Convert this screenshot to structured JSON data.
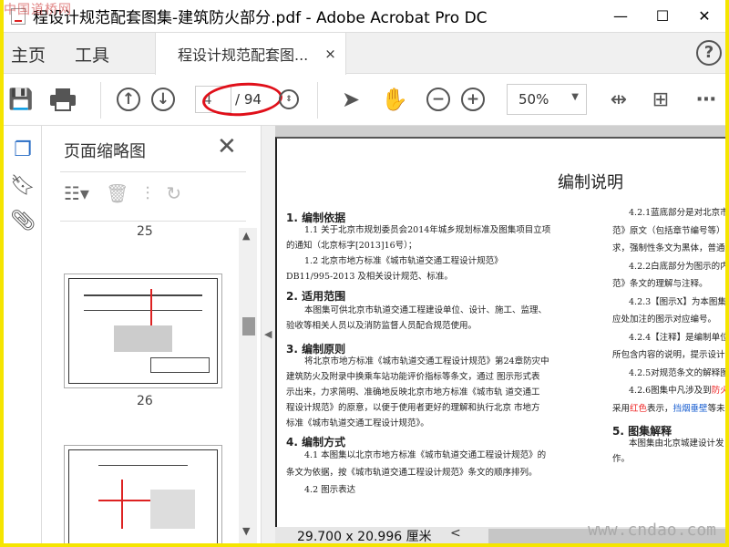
{
  "watermark_top": "中国道桥网",
  "watermark_bottom": "www.cndao.com",
  "window": {
    "title": "程设计规范配套图集-建筑防火部分.pdf - Adobe Acrobat Pro DC",
    "minimize": "—",
    "maximize": "☐",
    "close": "✕"
  },
  "tabs": {
    "home": "主页",
    "tools": "工具",
    "document": "程设计规范配套图...",
    "close": "×",
    "help": "?"
  },
  "toolbar": {
    "current_page": "4",
    "total_pages": "/ 94",
    "zoom": "50%"
  },
  "thumbnails": {
    "title": "页面缩略图",
    "pages": [
      "25",
      "26"
    ]
  },
  "document": {
    "heading": "编制说明",
    "s1": "1. 编制依据",
    "s1_l1": "1.1 关于北京市规划委员会2014年城乡规划标准及图集项目立项",
    "s1_l2": "的通知（北京标字[2013]16号）；",
    "s1_l3": "1.2 北京市地方标准《城市轨道交通工程设计规范》",
    "s1_l4": "DB11/995-2013 及相关设计规范、标准。",
    "s2": "2. 适用范围",
    "s2_l1": "本图集可供北京市轨道交通工程建设单位、设计、施工、监理、",
    "s2_l2": "验收等相关人员以及消防监督人员配合规范使用。",
    "s3": "3. 编制原则",
    "s3_l1": "将北京市地方标准《城市轨道交通工程设计规范》第24章防灾中",
    "s3_l2": "建筑防火及附录中换乘车站功能评价指标等条文，通过 图示形式表",
    "s3_l3": "示出来，力求简明、准确地反映北京市地方标准《城市轨 道交通工",
    "s3_l4": "程设计规范》的原意，以便于使用者更好的理解和执行北京 市地方",
    "s3_l5": "标准《城市轨道交通工程设计规范》。",
    "s4": "4. 编制方式",
    "s4_l1": "4.1  本图集以北京市地方标准《城市轨道交通工程设计规范》的",
    "s4_l2": "条文为依据，按《城市轨道交通工程设计规范》条文的顺序排列。",
    "s4_l3": "4.2  图示表达",
    "r1": "4.2.1蓝底部分是对北京市",
    "r2": "范》原文（包括章节编号等）",
    "r3": "求，强制性条文为黑体，普通",
    "r4": "4.2.2白底部分为图示的内",
    "r5": "范》条文的理解与注释。",
    "r6": "4.2.3【图示X】为本图集",
    "r7": "应处加注的图示对应编号。",
    "r8": "4.2.4【注释】是编制单位",
    "r9": "所包含内容的说明，提示设计",
    "r10": "4.2.5对规范条文的解释图",
    "r11a": "4.2.6图集中凡涉及到",
    "r11b": "防火",
    "r12a": "采用",
    "r12b": "红色",
    "r12c": "表示，",
    "r12d": "挡烟垂壁",
    "r12e": "等未",
    "s5": "5. 图集解释",
    "r13": "本图集由北京城建设计发",
    "r14": "作。"
  },
  "status": {
    "dimensions": "29.700 x 20.996 厘米",
    "scroll_left": "<"
  }
}
